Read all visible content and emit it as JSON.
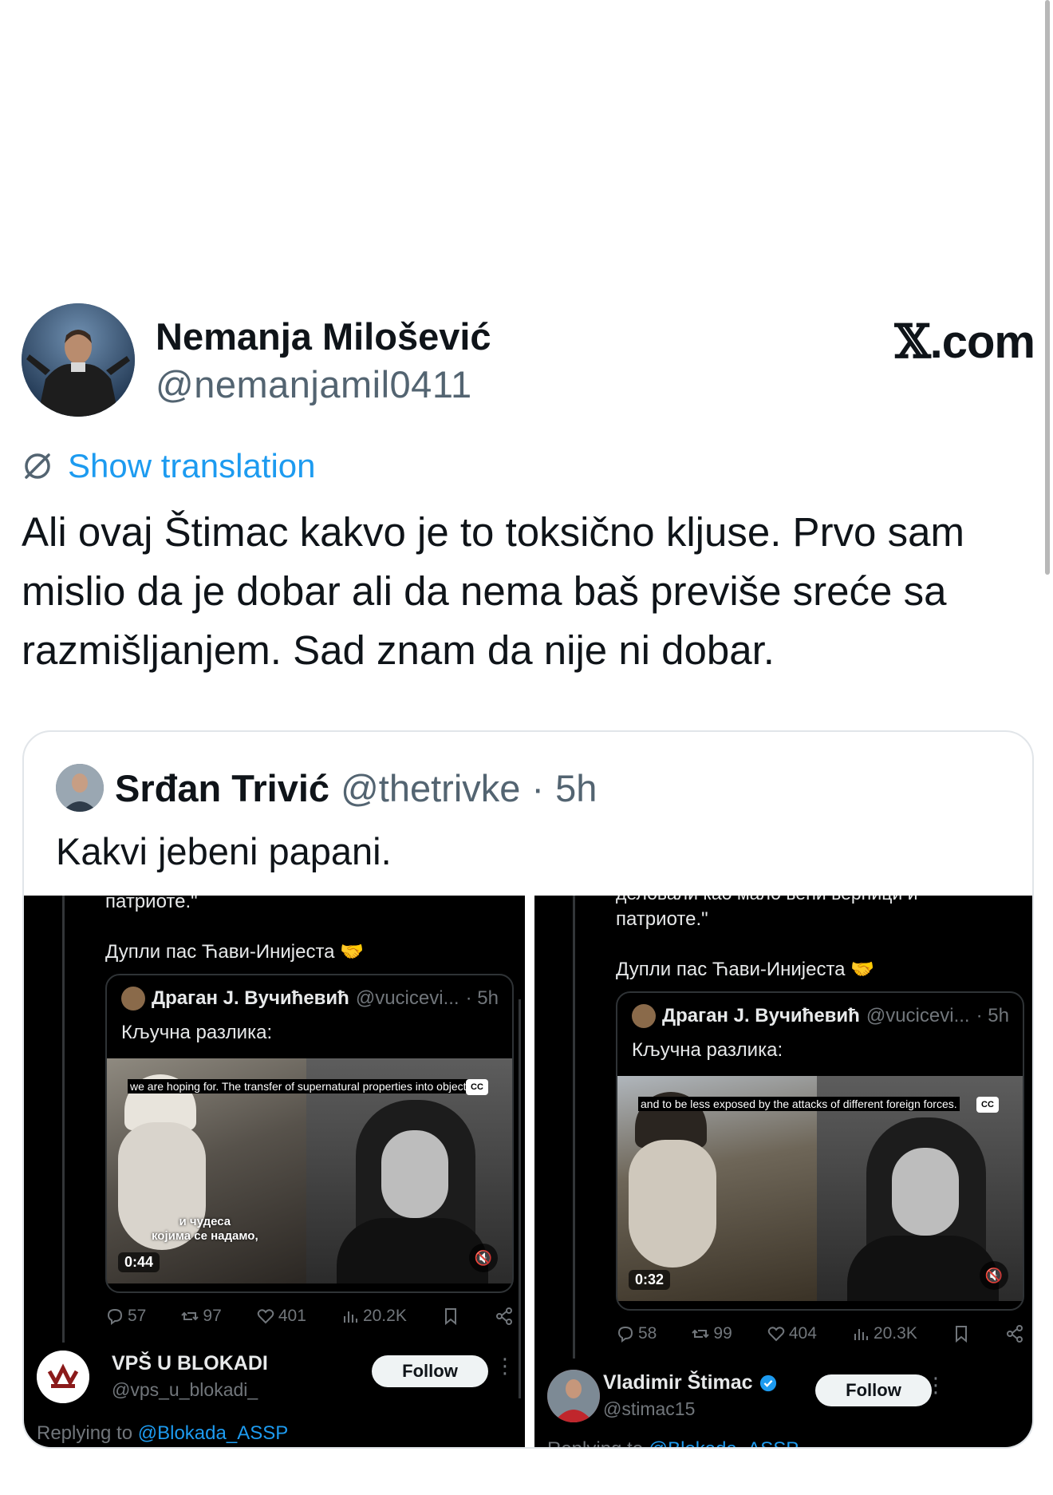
{
  "author": {
    "name": "Nemanja Milošević",
    "handle": "@nemanjamil0411"
  },
  "brand": {
    "x_mark": "𝕏",
    "suffix": ".com"
  },
  "translation_link": "Show translation",
  "tweet_text": "Ali ovaj Štimac kakvo je to toksično kljuse. Prvo sam mislio da je dobar ali da nema baš previše sreće sa razmišljanjem. Sad znam da nije ni dobar.",
  "quoted": {
    "name": "Srđan Trivić",
    "handle": "@thetrivke",
    "separator": "·",
    "time": "5h",
    "text": "Kakvi jebeni papani."
  },
  "screenshots": [
    {
      "top_cutoff": "патриоте.\"",
      "top_line": "",
      "pass_text": "Дупли пас Ћави-Инијеста 🤝",
      "inner": {
        "name": "Драган J. Вучићевић",
        "handle": "@vucicevi...",
        "time": "· 5h",
        "text": "Кључна разлика:"
      },
      "video": {
        "caption_top": "we are hoping for. The transfer of supernatural properties into objects",
        "caption_bottom": "и чудеса\nкојима се надамо,",
        "cc": "CC",
        "duration": "0:44"
      },
      "stats": {
        "replies": "57",
        "reposts": "97",
        "likes": "401",
        "views": "20.2K"
      },
      "user": {
        "name": "VPŠ U BLOKADI",
        "handle": "@vps_u_blokadi_",
        "follow": "Follow",
        "verified": false
      },
      "reply": {
        "prefix": "Replying to ",
        "mention": "@Blokada_ASSP"
      }
    },
    {
      "top_cutoff": "деловали као мало већи верници и",
      "top_line": "патриоте.\"",
      "pass_text": "Дупли пас Ћави-Инијеста 🤝",
      "inner": {
        "name": "Драган J. Вучићевић",
        "handle": "@vucicevi...",
        "time": "· 5h",
        "text": "Кључна разлика:"
      },
      "video": {
        "caption_top": "and to be less exposed by the attacks of different foreign forces.",
        "caption_bottom": "",
        "cc": "CC",
        "duration": "0:32"
      },
      "stats": {
        "replies": "58",
        "reposts": "99",
        "likes": "404",
        "views": "20.3K"
      },
      "user": {
        "name": "Vladimir Štimac",
        "handle": "@stimac15",
        "follow": "Follow",
        "verified": true
      },
      "reply": {
        "prefix": "Replying to ",
        "mention": "@Blokada_ASSP"
      }
    }
  ],
  "colors": {
    "link_blue": "#1d9bf0",
    "text": "#0f1419",
    "secondary": "#536471"
  }
}
